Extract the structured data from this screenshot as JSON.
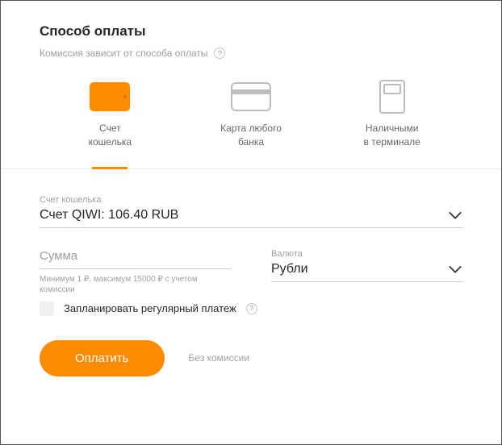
{
  "header": {
    "title": "Способ оплаты",
    "subtitle": "Комиссия зависит от способа оплаты",
    "help_glyph": "?"
  },
  "methods": {
    "wallet": {
      "label_l1": "Счет",
      "label_l2": "кошелька"
    },
    "card": {
      "label_l1": "Карта любого",
      "label_l2": "банка"
    },
    "cash": {
      "label_l1": "Наличными",
      "label_l2": "в терминале"
    }
  },
  "account": {
    "label": "Счет кошелька",
    "value": "Счет QIWI: 106.40 RUB"
  },
  "amount": {
    "placeholder": "Сумма",
    "hint": "Минимум 1 ₽, максимум 15000 ₽ с учетом комиссии"
  },
  "currency": {
    "label": "Валюта",
    "value": "Рубли"
  },
  "recurring": {
    "label": "Запланировать регулярный платеж",
    "help_glyph": "?"
  },
  "actions": {
    "pay": "Оплатить",
    "commission_note": "Без комиссии"
  }
}
